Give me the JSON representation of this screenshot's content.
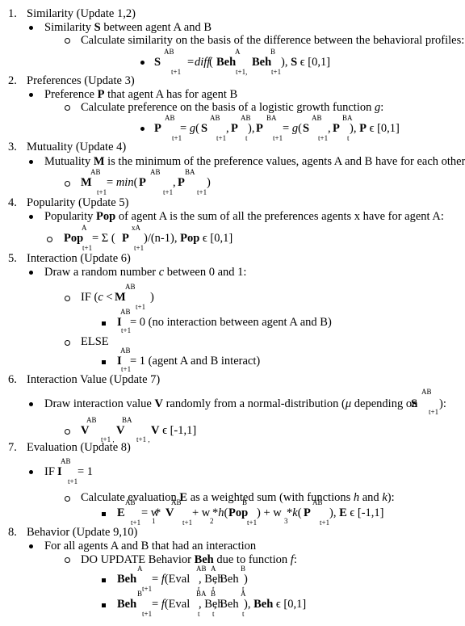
{
  "sections": [
    {
      "number": "1.",
      "title": "Similarity (Update 1,2)",
      "bullet": {
        "pre": "Similarity ",
        "bold": "S",
        "post": " between agent A and B"
      },
      "sub": "Calculate similarity on the basis of the difference between the behavioral profiles:",
      "formula": {
        "S": "S",
        "S_sup": "AB",
        "S_sub": "t+1",
        "eq": "= ",
        "fn": "diff",
        "open": " (",
        "beh1": "Beh",
        "beh1_sup": "A",
        "beh1_sub": "t+1,",
        "beh2": "Beh",
        "beh2_sup": "B",
        "beh2_sub": "t+1",
        "close": "), ",
        "range_var": "S",
        "range": " ϵ [0,1]"
      }
    },
    {
      "number": "2.",
      "title": "Preferences (Update 3)",
      "bullet": {
        "pre": "Preference ",
        "bold": "P",
        "post": " that agent A has for agent B"
      },
      "sub": {
        "pre": "Calculate preference on the basis of a logistic growth function ",
        "italic": "g",
        "post": ":"
      },
      "formula": {
        "P1": "P",
        "P1_sup": "AB",
        "P1_sub": "t+1",
        "eq1": "= ",
        "g1": "g",
        "open1": "(",
        "S1": "S",
        "S1_sup": "AB",
        "S1_sub": "t+1",
        "comma1": ", ",
        "P2": "P",
        "P2_sup": "AB",
        "P2_sub": "t",
        "close1": "), ",
        "P3": "P",
        "P3_sup": "BA",
        "P3_sub": "t+1",
        "eq2": "= ",
        "g2": "g",
        "open2": "(",
        "S2": "S",
        "S2_sup": "AB",
        "S2_sub": "t+1",
        "comma2": ", ",
        "P4": "P",
        "P4_sup": "BA",
        "P4_sub": "t",
        "close2": "), ",
        "range_var": "P",
        "range": " ϵ [0,1]"
      }
    },
    {
      "number": "3.",
      "title": "Mutuality (Update 4)",
      "bullet": {
        "pre": "Mutuality ",
        "bold": "M",
        "post": " is the minimum of the preference values, agents A and B have for each other:"
      },
      "formula": {
        "M": "M",
        "M_sup": "AB",
        "M_sub": "t+1",
        "eq": "= ",
        "fn": "min",
        "open": "(",
        "P1": "P",
        "P1_sup": "AB",
        "P1_sub": "t+1",
        "comma": ", ",
        "P2": "P",
        "P2_sup": "BA",
        "P2_sub": "t+1",
        "close": ")"
      }
    },
    {
      "number": "4.",
      "title": "Popularity (Update 5)",
      "bullet": {
        "pre": "Popularity ",
        "bold": "Pop",
        "post": " of agent A is the sum of all the preferences agents x have for agent A:"
      },
      "formula": {
        "Pop": "Pop",
        "Pop_sup": "A",
        "Pop_sub": "t+1",
        "eq": "= Σ (",
        "P": "P",
        "P_sup": "xA",
        "P_sub": "t+1",
        "close": ")/(n-1), ",
        "range_var": "Pop",
        "range": " ϵ [0,1]"
      }
    },
    {
      "number": "5.",
      "title": "Interaction (Update 6)",
      "bullet": {
        "pre": "Draw a random number ",
        "italic": "c",
        "post": " between 0 and 1:"
      },
      "if": {
        "pre": "IF (",
        "c": "c",
        "lt": " < ",
        "M": "M",
        "M_sup": "AB",
        "M_sub": "t+1",
        "close": ")"
      },
      "if_result": {
        "I": "I",
        "I_sup": "AB",
        "I_sub": "t+1",
        "text": "= 0 (no interaction between agent A and B)"
      },
      "else": "ELSE",
      "else_result": {
        "I": "I",
        "I_sup": "AB",
        "I_sub": "t+1",
        "text": "= 1 (agent A and B interact)"
      }
    },
    {
      "number": "6.",
      "title": "Interaction Value (Update 7)",
      "bullet": {
        "pre": "Draw interaction value ",
        "bold": "V",
        "mid": " randomly from a normal-distribution (",
        "mu": "μ",
        "post": " depending on ",
        "S": "S",
        "S_sup": "AB",
        "S_sub": "t+1",
        "end": "):"
      },
      "formula": {
        "V1": "V",
        "V1_sup": "AB",
        "V1_sub": "t+1 ,",
        "V2": "V",
        "V2_sup": "BA",
        "V2_sub": "t+1 ,",
        "range_var": "V",
        "range": " ϵ [-1,1]"
      }
    },
    {
      "number": "7.",
      "title": "Evaluation (Update 8)",
      "bullet": {
        "pre": "IF  ",
        "I": "I",
        "I_sup": "AB",
        "I_sub": "t+1",
        "post": "= 1"
      },
      "sub": {
        "pre": "Calculate evaluation ",
        "bold": "E",
        "mid": " as a weighted sum (with functions ",
        "h": "h",
        "and": " and ",
        "k": "k",
        "post": "):"
      },
      "formula": {
        "E": "E",
        "E_sup": "AB",
        "E_sub": "t+1",
        "eq": "= w",
        "w1_sub": "1",
        "star1": " * ",
        "V": "V",
        "V_sup": "AB",
        "V_sub": "t+1",
        "plus1": " + w",
        "w2_sub": "2",
        "star2": " *",
        "h": "h",
        "open1": "(",
        "Pop": "Pop",
        "Pop_sup": "B",
        "Pop_sub": "t+1",
        "close1": ") + w",
        "w3_sub": "3",
        "star3": " *",
        "k": "k",
        "open2": "(",
        "P": "P",
        "P_sup": "AB",
        "P_sub": "t+1",
        "close2": "), ",
        "range_var": "E",
        "range": " ϵ [-1,1]"
      }
    },
    {
      "number": "8.",
      "title": "Behavior (Update 9,10)",
      "bullet": "For all agents A and B that had an interaction",
      "sub": {
        "pre": "DO UPDATE  Behavior ",
        "bold": "Beh",
        "mid": " due to function ",
        "f": "f",
        "post": ":"
      },
      "formula1": {
        "Beh": "Beh",
        "Beh_sup": "A",
        "Beh_sub": "t+1",
        "eq": "= ",
        "f": "f",
        "open": "(Eval",
        "Eval_sup": "AB",
        "Eval_sub": "t",
        "c1": ", Beh",
        "b1_sup": "A",
        "b1_sub": "t",
        "c2": ", Beh",
        "b2_sup": "B",
        "b2_sub": "t",
        "close": ")"
      },
      "formula2": {
        "Beh": "Beh",
        "Beh_sup": "B",
        "Beh_sub": "t+1",
        "eq": "= ",
        "f": "f",
        "open": "(Eval",
        "Eval_sup": "BA",
        "Eval_sub": "t",
        "c1": ", Beh",
        "b1_sup": "B",
        "b1_sub": "t",
        "c2": ", Beh",
        "b2_sup": "A",
        "b2_sub": "t",
        "close": "), ",
        "range_var": "Beh",
        "range": " ϵ [0,1]"
      }
    }
  ]
}
